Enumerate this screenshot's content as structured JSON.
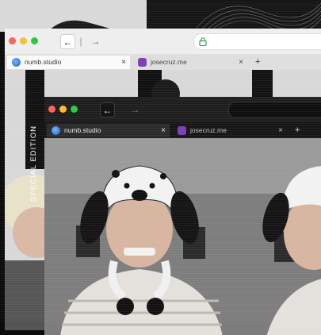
{
  "windows": [
    {
      "theme": "light",
      "tabs": [
        {
          "label": "numb.studio",
          "icon": "edge-icon",
          "active": true
        },
        {
          "label": "josecruz.me",
          "icon": "site-favicon-purple",
          "active": false
        }
      ],
      "new_tab_label": "+",
      "nav": {
        "back": "←",
        "divider": "|",
        "forward": "→"
      },
      "lock_icon": "lock-icon",
      "close_glyph": "×"
    },
    {
      "theme": "dark",
      "tabs": [
        {
          "label": "numb.studio",
          "icon": "edge-icon",
          "active": true
        },
        {
          "label": "josecruz.me",
          "icon": "site-favicon-purple",
          "active": false
        }
      ],
      "new_tab_label": "+",
      "nav": {
        "back": "←",
        "forward": "→"
      },
      "close_glyph": "×"
    }
  ],
  "poster": {
    "vertical_text": "SPECIAL EDITION"
  },
  "colors": {
    "traffic_red": "#ff5f57",
    "traffic_yellow": "#febc2e",
    "traffic_green": "#28c840",
    "tab_icon_blue": "#2a7de1",
    "tab_icon_purple": "#7b3fb5"
  }
}
